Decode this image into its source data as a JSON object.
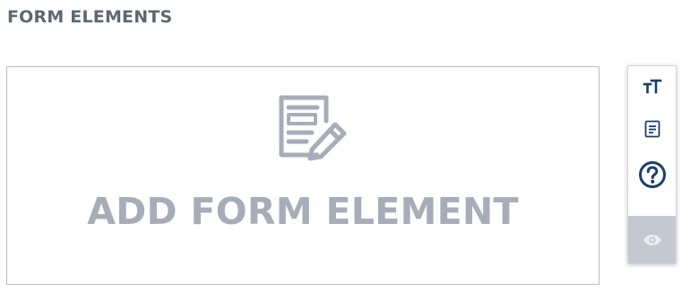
{
  "page": {
    "section_title": "FORM ELEMENTS"
  },
  "dropzone": {
    "label": "ADD FORM ELEMENT",
    "icon": "form-edit-icon"
  },
  "toolbar": {
    "buttons": [
      {
        "icon": "text-size-icon"
      },
      {
        "icon": "document-icon"
      },
      {
        "icon": "help-circle-icon"
      },
      {
        "icon": "eye-icon"
      }
    ]
  },
  "colors": {
    "title_text": "#5f6872",
    "dropzone_border": "#b8bdc4",
    "dropzone_muted": "#a7adb8",
    "toolbar_icon": "#1a3f6b",
    "preview_bg": "#c3c8d1",
    "preview_icon": "#e9ecf0"
  }
}
